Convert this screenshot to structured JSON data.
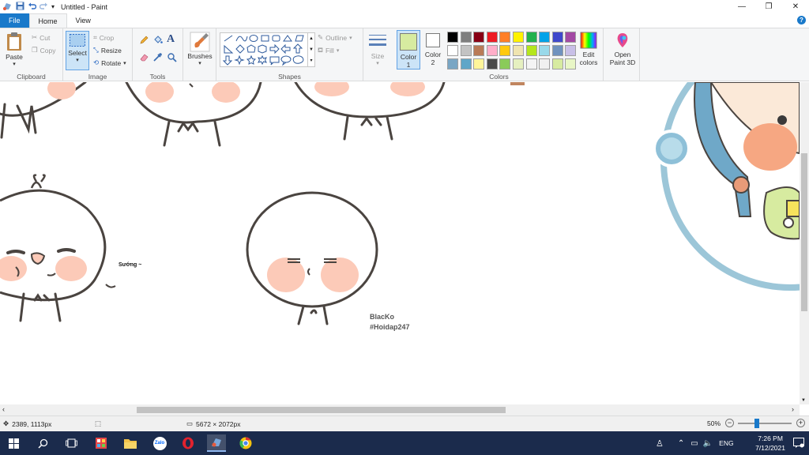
{
  "window": {
    "title": "Untitled - Paint",
    "min_glyph": "—",
    "max_glyph": "❐",
    "close_glyph": "✕",
    "help_glyph": "?"
  },
  "tabs": [
    {
      "label": "File"
    },
    {
      "label": "Home"
    },
    {
      "label": "View"
    }
  ],
  "clipboard": {
    "paste": "Paste",
    "cut": "Cut",
    "copy": "Copy",
    "label": "Clipboard"
  },
  "image": {
    "select": "Select",
    "crop": "Crop",
    "resize": "Resize",
    "rotate": "Rotate",
    "label": "Image"
  },
  "tools": {
    "label": "Tools",
    "text_glyph": "A"
  },
  "brushes": {
    "label": "Brushes"
  },
  "shapes": {
    "outline": "Outline",
    "fill": "Fill",
    "label": "Shapes"
  },
  "size": {
    "label": "Size"
  },
  "colors": {
    "color1": "Color 1",
    "color1_line1": "Color",
    "color1_line2": "1",
    "color2_line1": "Color",
    "color2_line2": "2",
    "edit_line1": "Edit",
    "edit_line2": "colors",
    "label": "Colors",
    "color1_value": "#d7eba0",
    "color2_value": "#ffffff",
    "palette_row1": [
      "#000000",
      "#7f7f7f",
      "#880015",
      "#ed1c24",
      "#ff7f27",
      "#fff200",
      "#22b14c",
      "#00a2e8",
      "#3f48cc",
      "#a349a4"
    ],
    "palette_row2": [
      "#ffffff",
      "#c3c3c3",
      "#b97a57",
      "#ffaec9",
      "#ffc90e",
      "#efe4b0",
      "#b5e61d",
      "#99d9ea",
      "#7092be",
      "#c8bfe7"
    ],
    "palette_row3": [
      "#79a6c4",
      "#5fa6c8",
      "#fff59a",
      "#4a4a4a",
      "#8acb59",
      "#e6f0c0",
      "#f4f4f4",
      "#f0f0f0",
      "#d7eba0",
      "#e8f6c6"
    ]
  },
  "paint3d": {
    "line1": "Open",
    "line2": "Paint 3D"
  },
  "canvas": {
    "label_suong": "Sướng ~",
    "label_blacko": "BlacKo",
    "label_hoidap": "#Hoidap247"
  },
  "status": {
    "cursor_pos": "2389, 1113px",
    "image_size": "5672 × 2072px",
    "zoom": "50%",
    "zoom_value": 50,
    "zoom_out_glyph": "−",
    "zoom_in_glyph": "+"
  },
  "taskbar": {
    "zalo": "Zalo",
    "lang": "ENG",
    "time": "7:26 PM",
    "date": "7/12/2021"
  }
}
